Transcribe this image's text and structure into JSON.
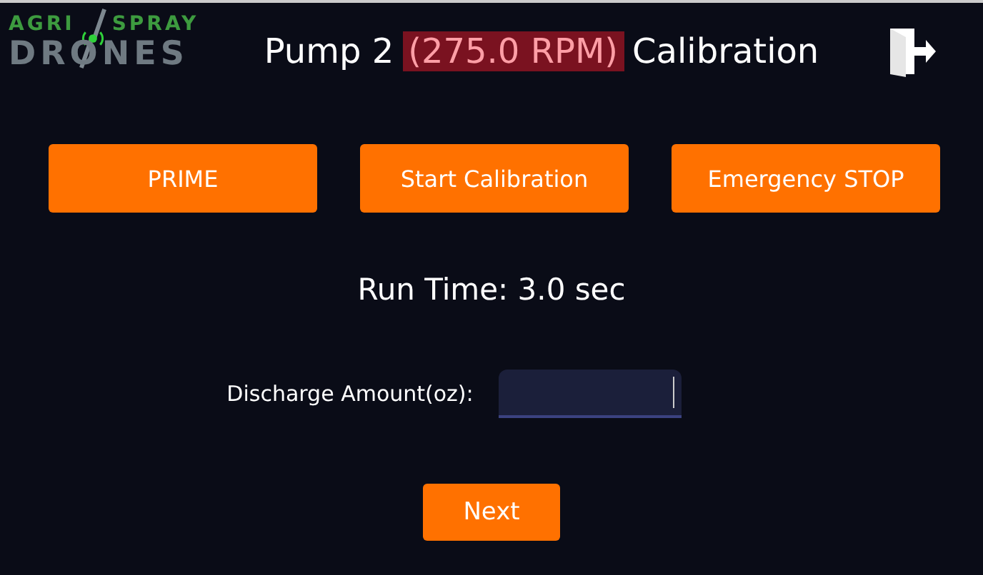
{
  "logo": {
    "top_left": "AGRI",
    "top_right": "SPRAY",
    "bottom": "DRONES"
  },
  "title": {
    "prefix": "Pump 2",
    "rpm": "(275.0 RPM)",
    "suffix": "Calibration",
    "rpm_highlighted": true
  },
  "buttons": [
    {
      "label": "PRIME"
    },
    {
      "label": "Start Calibration"
    },
    {
      "label": "Emergency STOP"
    }
  ],
  "run_time": "Run Time: 3.0 sec",
  "discharge": {
    "label": "Discharge Amount(oz):"
  },
  "next_button": "Next"
}
